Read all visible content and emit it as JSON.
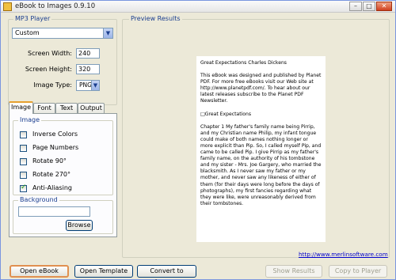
{
  "window": {
    "title": "eBook to Images 0.9.10",
    "minimize_glyph": "–",
    "maximize_glyph": "□",
    "close_glyph": "✕"
  },
  "mp3_player": {
    "group_label": "MP3 Player",
    "profile_value": "Custom",
    "screen_width_label": "Screen Width:",
    "screen_width_value": "240",
    "screen_height_label": "Screen Height:",
    "screen_height_value": "320",
    "image_type_label": "Image Type:",
    "image_type_value": "PNG"
  },
  "tabs": [
    {
      "label": "Image",
      "active": true
    },
    {
      "label": "Font",
      "active": false
    },
    {
      "label": "Text",
      "active": false
    },
    {
      "label": "Output",
      "active": false
    }
  ],
  "image_options": {
    "group_label": "Image",
    "checkboxes": [
      {
        "label": "Inverse Colors",
        "checked": false
      },
      {
        "label": "Page Numbers",
        "checked": false
      },
      {
        "label": "Rotate 90°",
        "checked": false
      },
      {
        "label": "Rotate 270°",
        "checked": false
      },
      {
        "label": "Anti-Aliasing",
        "checked": true
      }
    ]
  },
  "background": {
    "group_label": "Background",
    "value": "",
    "browse_label": "Browse"
  },
  "preview": {
    "group_label": "Preview Results",
    "paragraphs": [
      "Great Expectations Charles Dickens",
      "This eBook was designed and published by Planet PDF. For more free eBooks visit our Web site at http://www.planetpdf.com/. To hear about our latest releases subscribe to the Planet PDF Newsletter.",
      "□Great Expectations",
      "Chapter 1 My father's family name being Pirrip, and my Christian name Philip, my infant tongue could make of both names nothing longer or more explicit than Pip. So, I called myself Pip, and came to be called Pip. I give Pirrip as my father's family name, on the authority of his tombstone and my sister - Mrs. Joe Gargery, who married the blacksmith. As I never saw my father or my mother, and never saw any likeness of either of them (for their days were long before the days of photographs), my first fancies regarding what they were like, were unreasonably derived from their tombstones."
    ],
    "link": "http://www.merlinsoftware.com"
  },
  "buttons": {
    "open_ebook": "Open eBook",
    "open_template": "Open Template",
    "convert": "Convert to Images",
    "show_results": "Show Results",
    "copy_to_player": "Copy to Player"
  }
}
